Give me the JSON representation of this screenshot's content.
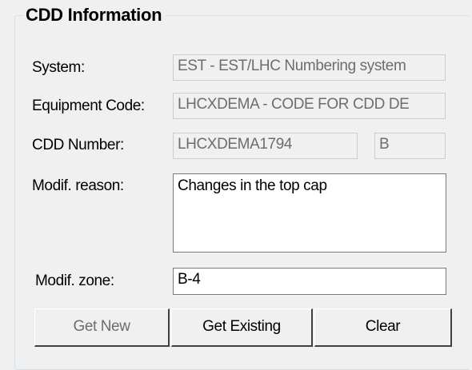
{
  "group": {
    "title": "CDD Information"
  },
  "fields": {
    "system": {
      "label": "System:",
      "value": "EST - EST/LHC Numbering system"
    },
    "equipment_code": {
      "label": "Equipment Code:",
      "value": "LHCXDEMA - CODE FOR CDD DE"
    },
    "cdd_number": {
      "label": "CDD Number:",
      "value": "LHCXDEMA1794",
      "revision": "B"
    },
    "modif_reason": {
      "label": "Modif. reason:",
      "value": "Changes in the top cap"
    },
    "modif_zone": {
      "label": "Modif. zone:",
      "value": "B-4"
    }
  },
  "buttons": {
    "get_new": "Get New",
    "get_existing": "Get Existing",
    "clear": "Clear"
  }
}
